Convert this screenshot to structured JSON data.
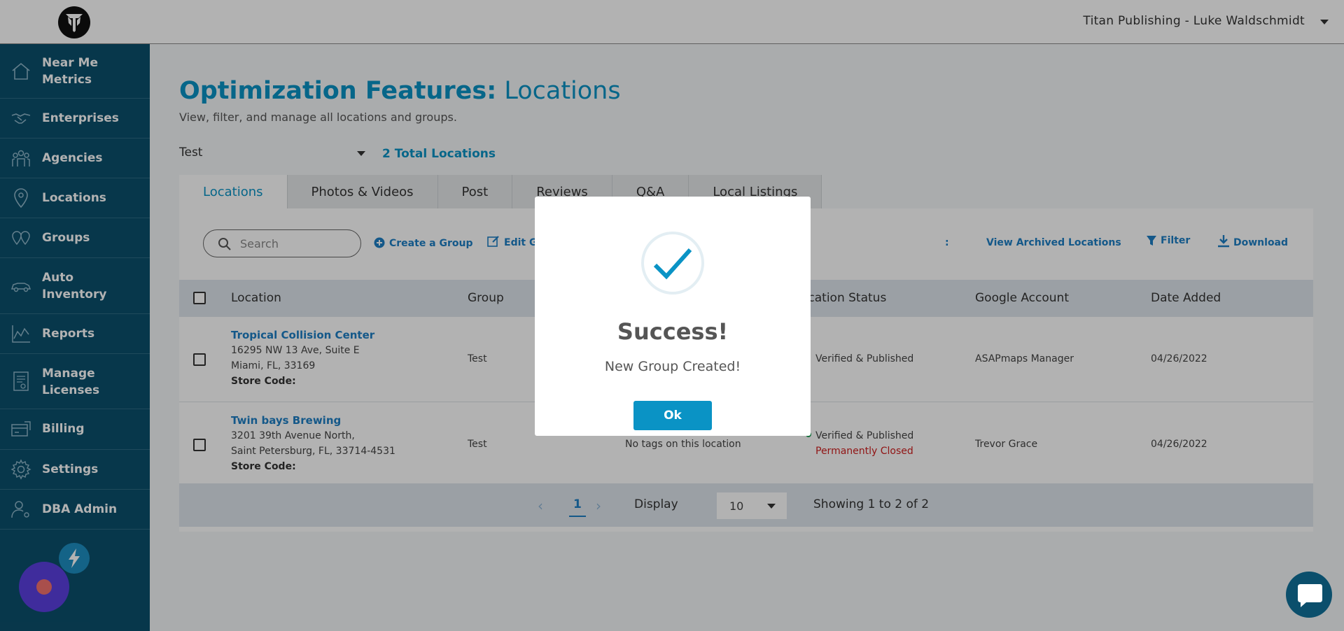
{
  "topbar": {
    "account_label": "Titan Publishing - Luke Waldschmidt",
    "logo_icon": "titan-logo-icon"
  },
  "sidebar": {
    "items": [
      {
        "label": "Near Me Metrics",
        "icon": "home-icon"
      },
      {
        "label": "Enterprises",
        "icon": "handshake-icon"
      },
      {
        "label": "Agencies",
        "icon": "people-group-icon"
      },
      {
        "label": "Locations",
        "icon": "map-pin-icon"
      },
      {
        "label": "Groups",
        "icon": "pins-group-icon"
      },
      {
        "label": "Auto Inventory",
        "icon": "car-icon"
      },
      {
        "label": "Reports",
        "icon": "line-chart-icon"
      },
      {
        "label": "Manage Licenses",
        "icon": "license-icon"
      },
      {
        "label": "Billing",
        "icon": "billing-icon"
      },
      {
        "label": "Settings",
        "icon": "gear-icon"
      },
      {
        "label": "DBA Admin",
        "icon": "admin-user-icon"
      }
    ]
  },
  "page": {
    "title_bold": "Optimization Features:",
    "title_light": " Locations",
    "subtitle": "View, filter, and manage all locations and groups.",
    "group_selected": "Test",
    "total_locations": "2 Total Locations"
  },
  "tabs": [
    "Locations",
    "Photos & Videos",
    "Post",
    "Reviews",
    "Q&A",
    "Local Listings"
  ],
  "toolbar": {
    "search_placeholder": "Search",
    "create_group": "Create a Group",
    "edit_group": "Edit G",
    "colon_fragment": ":",
    "view_archived": "View Archived Locations",
    "filter": "Filter",
    "download": "Download"
  },
  "table": {
    "headers": {
      "location": "Location",
      "group": "Group",
      "location_status": "ocation Status",
      "google_account": "Google Account",
      "date_added": "Date Added"
    },
    "rows": [
      {
        "name": "Tropical Collision Center",
        "address1": "16295 NW 13 Ave, Suite E",
        "address2": "Miami, FL, 33169",
        "store_code": "Store Code:",
        "group": "Test",
        "tags": "",
        "status": "Verified & Published",
        "status_extra": "",
        "google_account": "ASAPmaps Manager",
        "date_added": "04/26/2022"
      },
      {
        "name": "Twin bays Brewing",
        "address1": "3201 39th Avenue North,",
        "address2": "Saint Petersburg, FL, 33714-4531",
        "store_code": "Store Code:",
        "group": "Test",
        "tags": "No tags on this location",
        "status": "Verified & Published",
        "status_extra": "Permanently Closed",
        "google_account": "Trevor Grace",
        "date_added": "04/26/2022"
      }
    ]
  },
  "pager": {
    "prev": "‹",
    "page": "1",
    "next": "›",
    "display_label": "Display",
    "display_value": "10",
    "showing": "Showing 1 to 2 of 2"
  },
  "modal": {
    "title": "Success!",
    "message": "New Group Created!",
    "ok_label": "Ok"
  },
  "colors": {
    "accent": "#0a93c5",
    "sidebar": "#0b4f6c",
    "closed": "#d02020"
  }
}
